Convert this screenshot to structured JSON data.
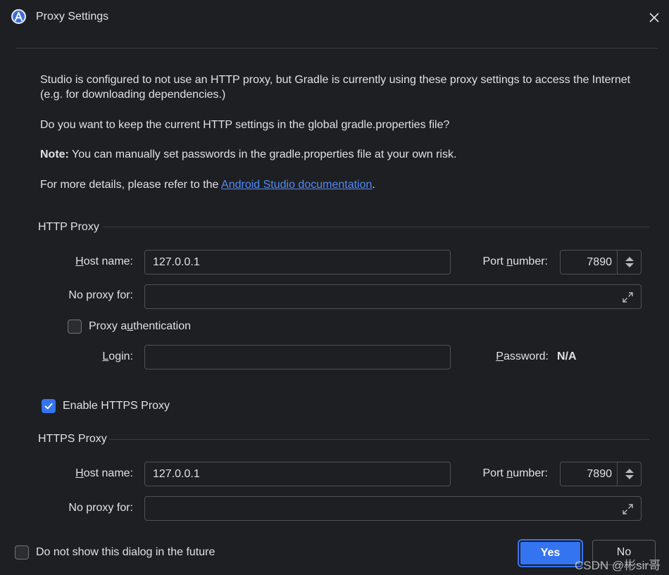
{
  "window": {
    "title": "Proxy Settings",
    "logo_icon": "android-studio-icon"
  },
  "intro": {
    "p1": "Studio is configured to not use an HTTP proxy, but Gradle is currently using these proxy settings to access the Internet (e.g. for downloading dependencies.)",
    "p2": "Do you want to keep the current HTTP settings in the global gradle.properties file?",
    "note_label": "Note:",
    "note_text": " You can manually set passwords in the gradle.properties file at your own risk.",
    "details_prefix": "For more details, please refer to the ",
    "details_link": "Android Studio documentation",
    "details_suffix": "."
  },
  "http_proxy": {
    "group_title": "HTTP Proxy",
    "host_label_u": "H",
    "host_label_rest": "ost name:",
    "host_value": "127.0.0.1",
    "port_label_pre": "Port ",
    "port_label_u": "n",
    "port_label_rest": "umber:",
    "port_value": "7890",
    "no_proxy_label": "No proxy for:",
    "no_proxy_value": "",
    "auth_label_pre": "Proxy a",
    "auth_label_u": "u",
    "auth_label_rest": "thentication",
    "auth_checked": false,
    "login_label_u": "L",
    "login_label_rest": "ogin:",
    "login_value": "",
    "password_label_u": "P",
    "password_label_rest": "assword:",
    "password_value": "N/A"
  },
  "https_toggle": {
    "label": "Enable HTTPS Proxy",
    "checked": true
  },
  "https_proxy": {
    "group_title": "HTTPS Proxy",
    "host_label_u": "H",
    "host_label_rest": "ost name:",
    "host_value": "127.0.0.1",
    "port_label_pre": "Port ",
    "port_label_u": "n",
    "port_label_rest": "umber:",
    "port_value": "7890",
    "no_proxy_label": "No proxy for:",
    "no_proxy_value": ""
  },
  "footer": {
    "dont_show_label": "Do not show this dialog in the future",
    "dont_show_checked": false,
    "yes_label": "Yes",
    "no_label": "No"
  },
  "watermark": "CSDN @彬sir哥",
  "colors": {
    "background": "#1e1f22",
    "accent": "#3574f0",
    "link": "#548af7",
    "border": "#4e5157"
  }
}
